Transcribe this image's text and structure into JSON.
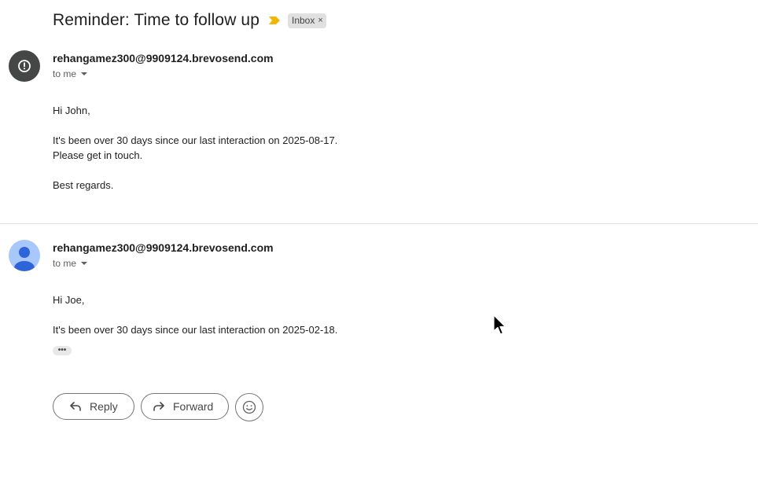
{
  "subject": "Reminder: Time to follow up",
  "label_chip": {
    "text": "Inbox",
    "close": "×"
  },
  "colors": {
    "importance": "#f2b705",
    "dark_avatar": "#444746",
    "blue_avatar": "#a8c7fa",
    "avatar_person": "#2f63d8"
  },
  "messages": [
    {
      "sender": "rehangamez300@9909124.brevosend.com",
      "to": "to me",
      "avatar_icon": "alert-circle-icon",
      "body": [
        "Hi John,",
        "It's been over 30 days since our last interaction on 2025-08-17.",
        "Please get in touch.",
        "Best regards."
      ]
    },
    {
      "sender": "rehangamez300@9909124.brevosend.com",
      "to": "to me",
      "avatar_icon": "person-icon",
      "body": [
        "Hi Joe,",
        "It's been over 30 days since our last interaction on 2025-02-18."
      ],
      "trimmed_content": "•••"
    }
  ],
  "actions": {
    "reply": "Reply",
    "forward": "Forward"
  }
}
